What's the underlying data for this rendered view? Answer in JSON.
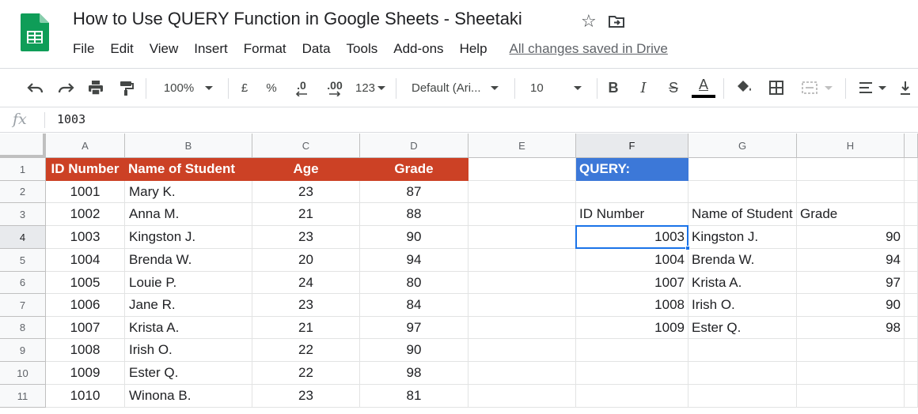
{
  "doc": {
    "title": "How to Use QUERY Function in Google Sheets - Sheetaki",
    "save_status": "All changes saved in Drive"
  },
  "menu": [
    "File",
    "Edit",
    "View",
    "Insert",
    "Format",
    "Data",
    "Tools",
    "Add-ons",
    "Help"
  ],
  "toolbar": {
    "zoom": "100%",
    "currency": "£",
    "percent": "%",
    "decrease_decimal": ".0",
    "increase_decimal": ".00",
    "more_formats": "123",
    "font": "Default (Ari...",
    "font_size": "10",
    "bold": "B",
    "italic": "I",
    "strike": "S",
    "text_color": "A",
    "accent_colors": {
      "text_color_bar": "#000000",
      "selection": "#1a73e8"
    }
  },
  "formula_bar": {
    "fx_label": "fx",
    "value": "1003"
  },
  "sheet": {
    "columns": [
      "A",
      "B",
      "C",
      "D",
      "E",
      "F",
      "G",
      "H"
    ],
    "row_numbers": [
      "1",
      "2",
      "3",
      "4",
      "5",
      "6",
      "7",
      "8",
      "9",
      "10",
      "11"
    ],
    "active_column": "F",
    "active_row": "4",
    "header_fill": "#cc4125",
    "query_fill": "#3c78d8",
    "table_headers": [
      "ID Number",
      "Name of Student",
      "Age",
      "Grade"
    ],
    "table_rows": [
      [
        "1001",
        "Mary K.",
        "23",
        "87"
      ],
      [
        "1002",
        "Anna M.",
        "21",
        "88"
      ],
      [
        "1003",
        "Kingston J.",
        "23",
        "90"
      ],
      [
        "1004",
        "Brenda W.",
        "20",
        "94"
      ],
      [
        "1005",
        "Louie P.",
        "24",
        "80"
      ],
      [
        "1006",
        "Jane R.",
        "23",
        "84"
      ],
      [
        "1007",
        "Krista A.",
        "21",
        "97"
      ],
      [
        "1008",
        "Irish O.",
        "22",
        "90"
      ],
      [
        "1009",
        "Ester Q.",
        "22",
        "98"
      ],
      [
        "1010",
        "Winona B.",
        "23",
        "81"
      ]
    ],
    "query_label": "QUERY:",
    "result_headers": [
      "ID Number",
      "Name of Student",
      "Grade"
    ],
    "result_rows": [
      [
        "1003",
        "Kingston J.",
        "90"
      ],
      [
        "1004",
        "Brenda W.",
        "94"
      ],
      [
        "1007",
        "Krista A.",
        "97"
      ],
      [
        "1008",
        "Irish O.",
        "90"
      ],
      [
        "1009",
        "Ester Q.",
        "98"
      ]
    ]
  }
}
